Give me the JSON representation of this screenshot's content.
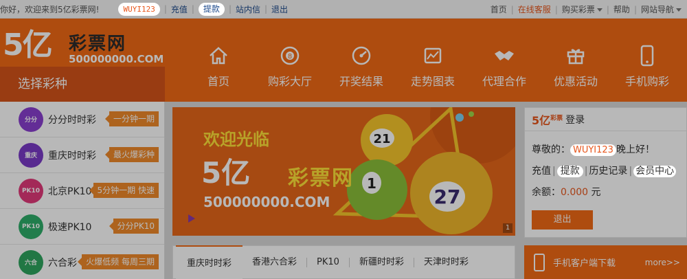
{
  "topbar": {
    "greeting": "你好，欢迎来到5亿彩票网!",
    "username": "WUYI123",
    "links": [
      "充值",
      "提款",
      "站内信",
      "退出"
    ],
    "right_links": [
      "首页",
      "在线客服",
      "购买彩票",
      "帮助",
      "网站导航"
    ]
  },
  "logo": {
    "big": "5亿",
    "cn": "彩票网",
    "domain": "500000000.COM"
  },
  "nav": {
    "items": [
      {
        "label": "首页",
        "icon": "home-icon"
      },
      {
        "label": "购彩大厅",
        "icon": "lottery-ball-icon"
      },
      {
        "label": "开奖结果",
        "icon": "dial-icon"
      },
      {
        "label": "走势图表",
        "icon": "chart-icon"
      },
      {
        "label": "代理合作",
        "icon": "handshake-icon"
      },
      {
        "label": "优惠活动",
        "icon": "gift-icon"
      },
      {
        "label": "手机购彩",
        "icon": "phone-icon"
      }
    ]
  },
  "sidebar": {
    "title": "选择彩种",
    "items": [
      {
        "name": "分分时时彩",
        "tag": "一分钟一期",
        "icon_text": "分分\n时时彩",
        "color": "#8a3fd0"
      },
      {
        "name": "重庆时时彩",
        "tag": "最火爆彩种",
        "icon_text": "重庆\n时时彩",
        "color": "#7a3bc8"
      },
      {
        "name": "北京PK10",
        "tag": "5分钟一期 快速",
        "icon_text": "PK10",
        "color": "#e23a7a"
      },
      {
        "name": "极速PK10",
        "tag": "分分PK10",
        "icon_text": "PK10",
        "color": "#2fae6a"
      },
      {
        "name": "六合彩",
        "tag": "火爆低频 每周三期",
        "icon_text": "六合彩",
        "color": "#2fa65f"
      }
    ]
  },
  "banner": {
    "welcome": "欢迎光临",
    "big": "5亿",
    "cn": "彩票网",
    "domain": "500000000.COM",
    "page": "1",
    "balls": [
      "21",
      "1",
      "27"
    ]
  },
  "tabs": [
    "重庆时时彩",
    "香港六合彩",
    "PK10",
    "新疆时时彩",
    "天津时时彩"
  ],
  "panel": {
    "logo": "5亿",
    "logo_small": "彩票",
    "title": "登录",
    "greet_prefix": "尊敬的：",
    "username": "WUYI123",
    "greet_suffix": "晚上好！",
    "deposit": "充值",
    "withdraw": "提款",
    "history": "历史记录",
    "member": "会员中心",
    "balance_label": "余额：",
    "balance": "0.000",
    "balance_unit": "元",
    "logout": "退出"
  },
  "appbar": {
    "text": "手机客户端下载",
    "more": "more>>"
  }
}
